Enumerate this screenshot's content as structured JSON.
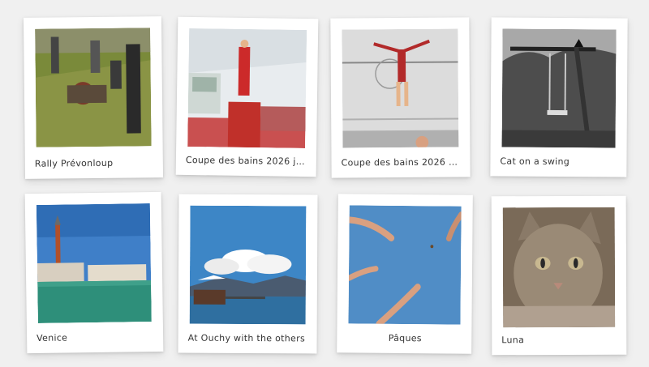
{
  "gallery": {
    "photos": [
      {
        "caption": "Rally Prévonloup",
        "scene": "grass-people"
      },
      {
        "caption": "Coupe des bains 2026 je...",
        "scene": "gymnastics-red"
      },
      {
        "caption": "Coupe des bains 2026 a...",
        "scene": "gym-leap"
      },
      {
        "caption": "Cat on a swing",
        "scene": "bw-swing"
      },
      {
        "caption": "Venice",
        "scene": "venice"
      },
      {
        "caption": "At Ouchy with the others",
        "scene": "lake-mountains"
      },
      {
        "caption": "Pâques",
        "scene": "hands-sky"
      },
      {
        "caption": "Luna",
        "scene": "cat-portrait"
      }
    ]
  },
  "colors": {
    "background": "#f0f0f0",
    "card": "#ffffff",
    "caption_text": "#333333"
  }
}
